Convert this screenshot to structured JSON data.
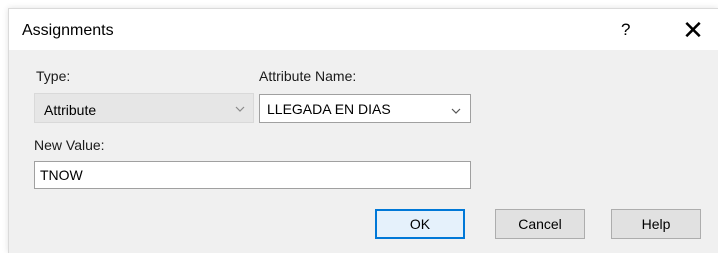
{
  "window": {
    "title": "Assignments",
    "help_glyph": "?",
    "close_glyph": "✕"
  },
  "form": {
    "type_label": "Type:",
    "type_value": "Attribute",
    "attribute_name_label": "Attribute Name:",
    "attribute_name_value": "LLEGADA EN DIAS",
    "new_value_label": "New Value:",
    "new_value_value": "TNOW"
  },
  "buttons": {
    "ok_label": "OK",
    "cancel_label": "Cancel",
    "help_label": "Help"
  },
  "icons": {
    "combo_arrow": "chevron-down-icon",
    "close": "close-icon"
  },
  "colors": {
    "default_button_border": "#0078d7",
    "default_button_fill": "#e5f1fb",
    "dialog_background": "#f0f0f0"
  }
}
